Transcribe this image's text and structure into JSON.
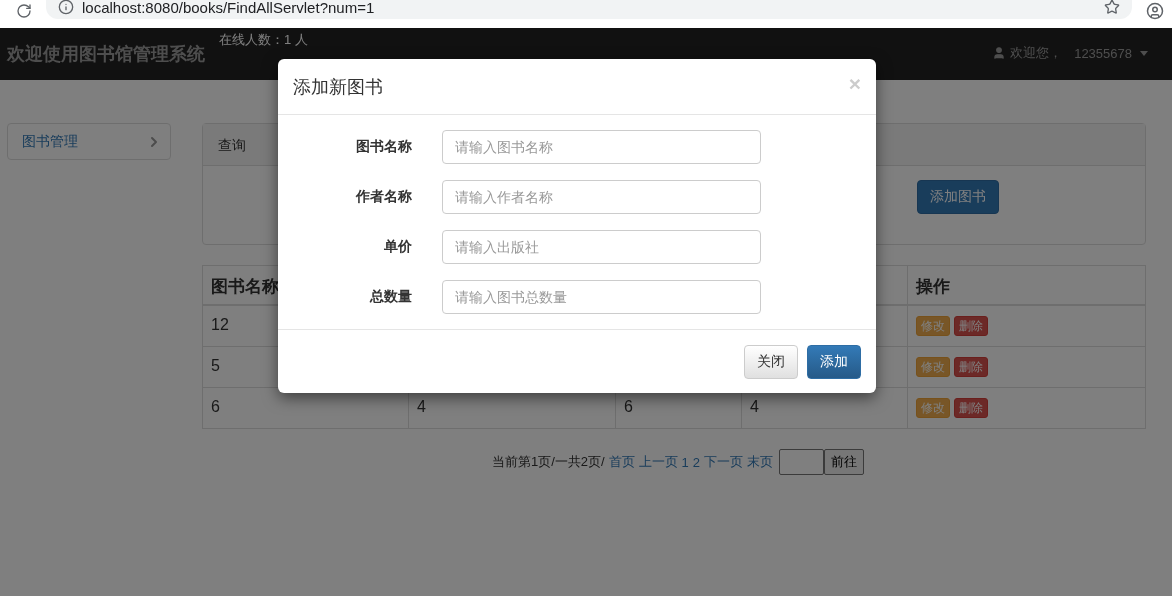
{
  "browser": {
    "url": "localhost:8080/books/FindAllServlet?num=1"
  },
  "navbar": {
    "brand": "欢迎使用图书馆管理系统",
    "online": "在线人数：1 人",
    "user_greeting": "欢迎您，",
    "user_name": "12355678"
  },
  "sidebar": {
    "items": [
      {
        "label": "图书管理"
      }
    ]
  },
  "query_panel": {
    "heading": "查询",
    "add_button": "添加图书"
  },
  "table": {
    "columns": [
      "图书名称",
      null,
      null,
      null,
      "操作"
    ],
    "rows": [
      {
        "cells": [
          "12",
          null,
          null,
          null
        ],
        "actions": [
          "修改",
          "删除"
        ]
      },
      {
        "cells": [
          "5",
          null,
          null,
          null
        ],
        "actions": [
          "修改",
          "删除"
        ]
      },
      {
        "cells": [
          "6",
          "4",
          "6",
          "4"
        ],
        "actions": [
          "修改",
          "删除"
        ]
      }
    ]
  },
  "pagination": {
    "status": "当前第1页/一共2页/",
    "links": [
      "首页",
      "上一页",
      "1",
      "2",
      "下一页",
      "末页"
    ],
    "go_button": "前往"
  },
  "modal": {
    "title": "添加新图书",
    "close": "×",
    "fields": [
      {
        "label": "图书名称",
        "placeholder": "请输入图书名称"
      },
      {
        "label": "作者名称",
        "placeholder": "请输入作者名称"
      },
      {
        "label": "单价",
        "placeholder": "请输入出版社"
      },
      {
        "label": "总数量",
        "placeholder": "请输入图书总数量"
      }
    ],
    "buttons": [
      {
        "label": "关闭",
        "kind": "default"
      },
      {
        "label": "添加",
        "kind": "primary"
      }
    ]
  }
}
